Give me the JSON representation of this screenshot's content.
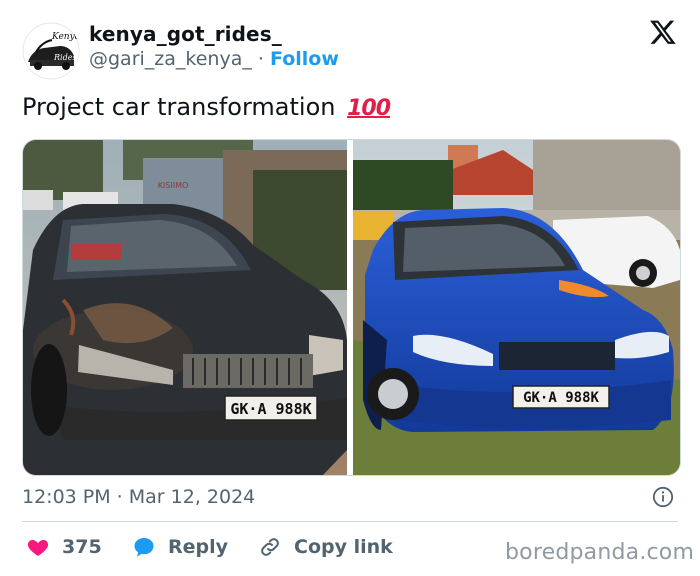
{
  "author": {
    "display_name": "kenya_got_rides_",
    "handle": "@gari_za_kenya_",
    "separator": "·",
    "follow_label": "Follow",
    "avatar_logo_text": [
      "Kenya",
      "Rides"
    ]
  },
  "tweet": {
    "text": "Project car transformation",
    "emoji": "100",
    "timestamp": "12:03 PM · Mar 12, 2024"
  },
  "media": {
    "before_plate": "GK·A 988K",
    "after_plate": "GK·A 988K",
    "before_sign": "KISIIMO"
  },
  "actions": {
    "like_count": "375",
    "reply_label": "Reply",
    "copy_label": "Copy link"
  },
  "icons": {
    "platform": "x-logo-icon",
    "info": "info-icon",
    "like": "heart-icon",
    "reply": "speech-bubble-icon",
    "copy": "link-icon"
  },
  "colors": {
    "like": "#f91880",
    "reply": "#1d9bf0",
    "follow": "#1d9bf0",
    "secondary_text": "#536471"
  },
  "watermark": "boredpanda.com"
}
